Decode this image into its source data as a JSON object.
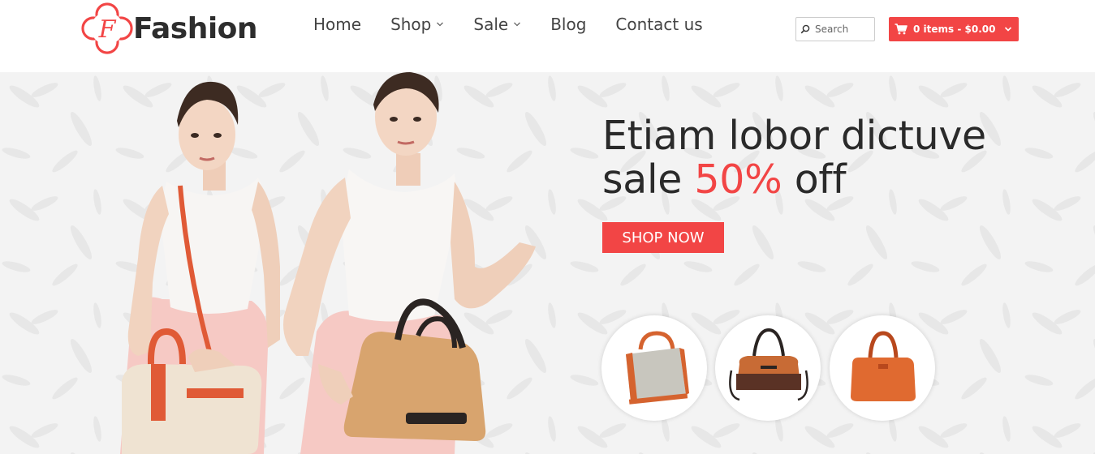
{
  "brand": {
    "name": "Fashion",
    "logo_letter": "F",
    "accent": "#f24545"
  },
  "nav": {
    "items": [
      {
        "label": "Home",
        "has_dropdown": false
      },
      {
        "label": "Shop",
        "has_dropdown": true
      },
      {
        "label": "Sale",
        "has_dropdown": true
      },
      {
        "label": "Blog",
        "has_dropdown": false
      },
      {
        "label": "Contact us",
        "has_dropdown": false
      }
    ]
  },
  "search": {
    "placeholder": "Search",
    "icon": "search-icon"
  },
  "cart": {
    "label": "0 items - $0.00",
    "icon": "cart-icon"
  },
  "hero": {
    "headline_line1": "Etiam lobor dictuve",
    "headline_line2_prefix": "sale ",
    "headline_line2_accent": "50%",
    "headline_line2_suffix": " off",
    "cta_label": "SHOP NOW",
    "thumbnails": [
      "grey-orange-handbag",
      "brown-shoulder-bag",
      "orange-tote-bag"
    ]
  }
}
